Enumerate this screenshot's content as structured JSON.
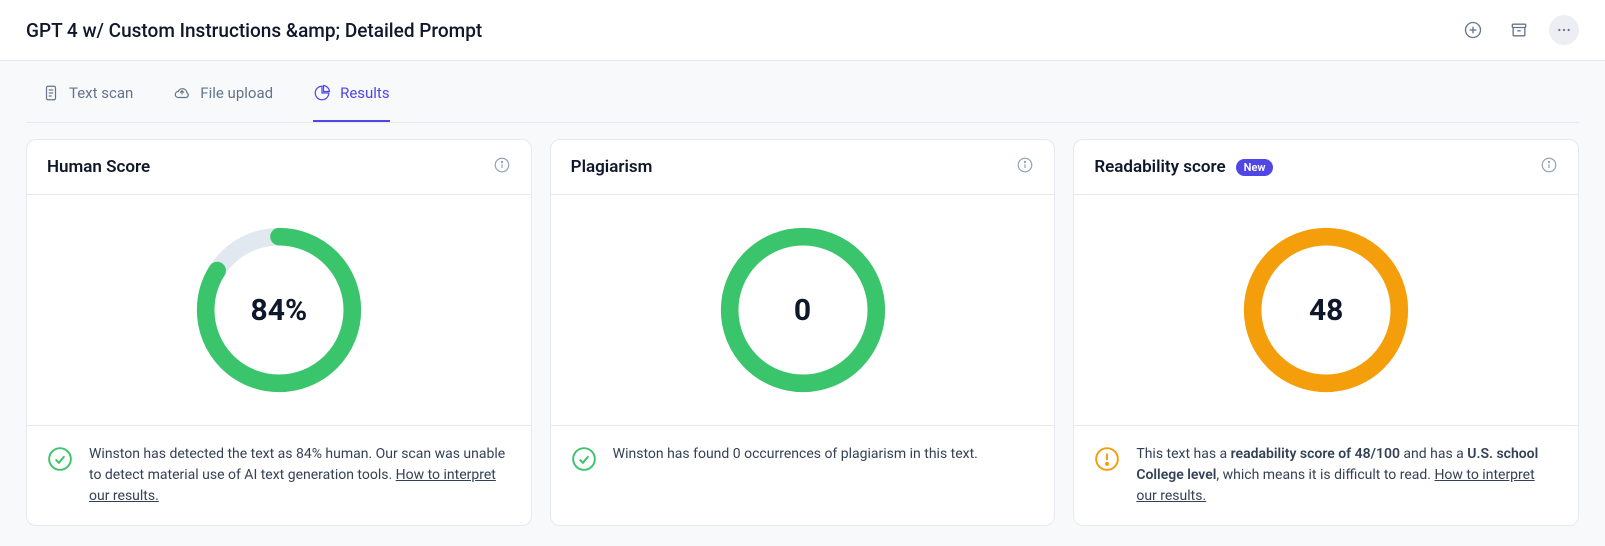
{
  "header": {
    "title": "GPT 4 w/ Custom Instructions &amp; Detailed Prompt"
  },
  "tabs": [
    {
      "label": "Text scan",
      "active": false
    },
    {
      "label": "File upload",
      "active": false
    },
    {
      "label": "Results",
      "active": true
    }
  ],
  "cards": {
    "human": {
      "title": "Human Score",
      "value_display": "84%",
      "ring_percent": 84,
      "ring_color": "#3ac46b",
      "footer_text": "Winston has detected the text as 84% human. Our scan was unable to detect material use of AI text generation tools.",
      "footer_link": "How to interpret our results.",
      "footer_icon_color": "#3ac46b"
    },
    "plagiarism": {
      "title": "Plagiarism",
      "value_display": "0",
      "ring_percent": 100,
      "ring_color": "#3ac46b",
      "footer_text": "Winston has found 0 occurrences of plagiarism in this text.",
      "footer_icon_color": "#3ac46b"
    },
    "readability": {
      "title": "Readability score",
      "badge": "New",
      "value_display": "48",
      "ring_percent": 100,
      "ring_color": "#f59e0b",
      "footer_pre": "This text has a ",
      "footer_bold1": "readability score of 48/100",
      "footer_mid": " and has a ",
      "footer_bold2": "U.S. school College level",
      "footer_post": ", which means it is difficult to read. ",
      "footer_link": "How to interpret our results.",
      "footer_icon_color": "#f59e0b"
    }
  },
  "chart_data": [
    {
      "type": "pie",
      "title": "Human Score",
      "values": [
        84
      ],
      "labels": [
        "Human %"
      ],
      "max": 100
    },
    {
      "type": "pie",
      "title": "Plagiarism",
      "values": [
        0
      ],
      "labels": [
        "Occurrences"
      ],
      "max": 100
    },
    {
      "type": "pie",
      "title": "Readability score",
      "values": [
        48
      ],
      "labels": [
        "Score"
      ],
      "max": 100
    }
  ]
}
